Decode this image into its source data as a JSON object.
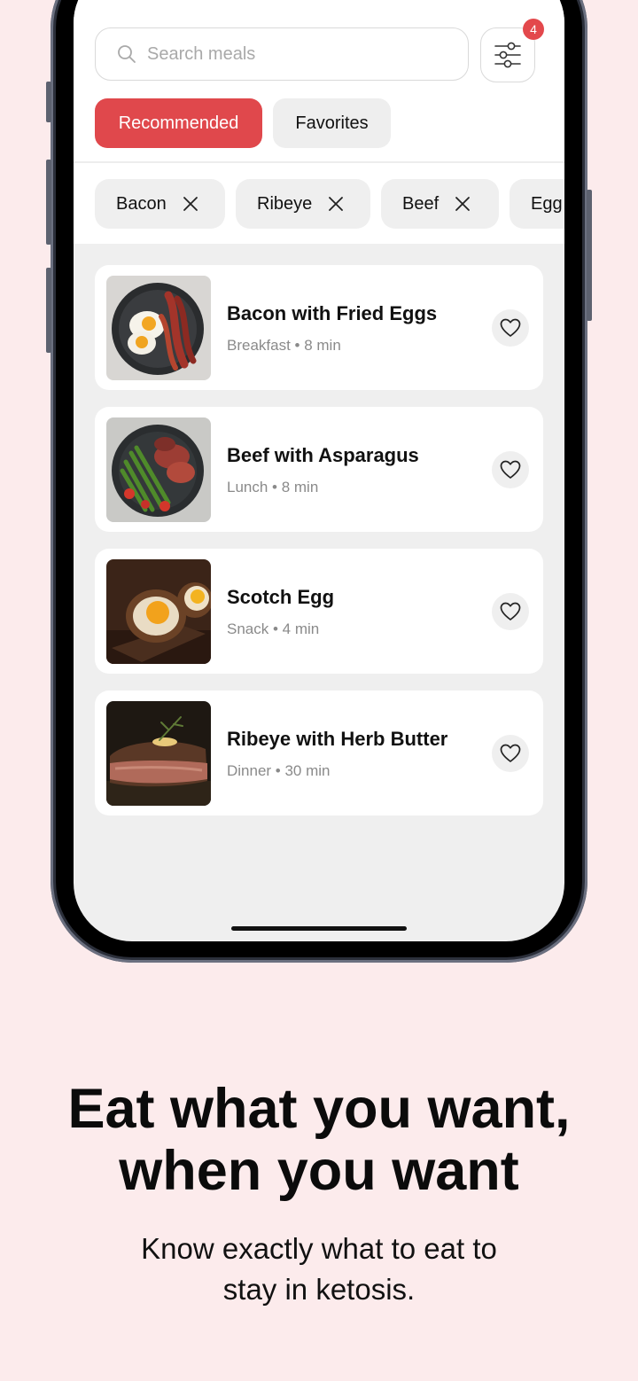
{
  "search": {
    "placeholder": "Search meals"
  },
  "filters": {
    "badge_count": "4"
  },
  "tabs": [
    {
      "label": "Recommended",
      "active": true
    },
    {
      "label": "Favorites",
      "active": false
    }
  ],
  "chips": [
    "Bacon",
    "Ribeye",
    "Beef",
    "Egg"
  ],
  "meals": [
    {
      "title": "Bacon with Fried Eggs",
      "meta": "Breakfast • 8 min",
      "image": "bacon-eggs-photo"
    },
    {
      "title": "Beef with Asparagus",
      "meta": "Lunch • 8 min",
      "image": "beef-asparagus-photo"
    },
    {
      "title": "Scotch Egg",
      "meta": "Snack • 4 min",
      "image": "scotch-egg-photo"
    },
    {
      "title": "Ribeye with Herb Butter",
      "meta": "Dinner • 30 min",
      "image": "ribeye-photo"
    }
  ],
  "marketing": {
    "headline_line1": "Eat what you want,",
    "headline_line2": "when you want",
    "sub_line1": "Know exactly what to eat to",
    "sub_line2": "stay in ketosis."
  },
  "colors": {
    "accent": "#e0484c",
    "background": "#fcebec"
  }
}
